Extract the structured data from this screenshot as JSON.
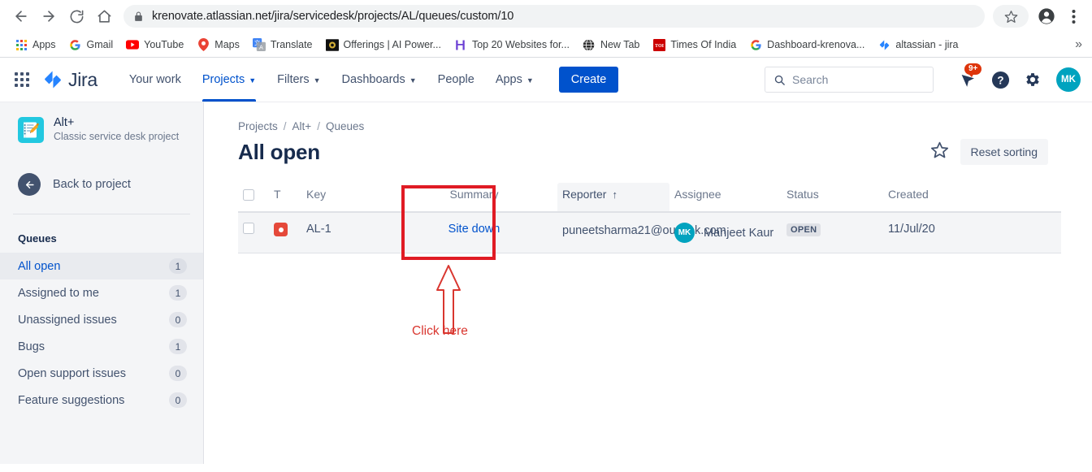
{
  "browser": {
    "url": "krenovate.atlassian.net/jira/servicedesk/projects/AL/queues/custom/10",
    "nav": {
      "back": "back-icon",
      "forward": "forward-icon",
      "reload": "reload-icon",
      "home": "home-icon"
    },
    "toolbar_right": {
      "bookmark_star": "star-icon",
      "profile": "profile-icon",
      "menu": "three-dot-menu-icon"
    },
    "bookmarks": [
      {
        "label": "Apps",
        "icon": "apps-grid-icon"
      },
      {
        "label": "Gmail",
        "icon": "gmail-icon"
      },
      {
        "label": "YouTube",
        "icon": "youtube-icon"
      },
      {
        "label": "Maps",
        "icon": "maps-pin-icon"
      },
      {
        "label": "Translate",
        "icon": "translate-icon"
      },
      {
        "label": "Offerings | AI Power...",
        "icon": "offerings-icon"
      },
      {
        "label": "Top 20 Websites for...",
        "icon": "top20-icon"
      },
      {
        "label": "New Tab",
        "icon": "globe-icon"
      },
      {
        "label": "Times Of India",
        "icon": "times-of-india-icon"
      },
      {
        "label": "Dashboard-krenova...",
        "icon": "google-icon"
      },
      {
        "label": "altassian - jira",
        "icon": "jira-icon"
      }
    ],
    "bookmarks_overflow": "»"
  },
  "jira_nav": {
    "app_switcher": "app-switcher-icon",
    "logo_text": "Jira",
    "items": [
      {
        "label": "Your work",
        "has_caret": false,
        "active": false
      },
      {
        "label": "Projects",
        "has_caret": true,
        "active": true
      },
      {
        "label": "Filters",
        "has_caret": true,
        "active": false
      },
      {
        "label": "Dashboards",
        "has_caret": true,
        "active": false
      },
      {
        "label": "People",
        "has_caret": false,
        "active": false
      },
      {
        "label": "Apps",
        "has_caret": true,
        "active": false
      }
    ],
    "create_label": "Create",
    "search_placeholder": "Search",
    "notification_count": "9+",
    "help_icon": "help-question-icon",
    "settings_icon": "gear-icon",
    "profile_initials": "MK",
    "profile_color": "#00a3bf"
  },
  "sidebar": {
    "project_name": "Alt+",
    "project_type": "Classic service desk project",
    "project_icon": "notepad-pencil-icon",
    "back_label": "Back to project",
    "back_icon": "arrow-left-circle-icon",
    "section_title": "Queues",
    "queues": [
      {
        "label": "All open",
        "count": "1",
        "active": true
      },
      {
        "label": "Assigned to me",
        "count": "1",
        "active": false
      },
      {
        "label": "Unassigned issues",
        "count": "0",
        "active": false
      },
      {
        "label": "Bugs",
        "count": "1",
        "active": false
      },
      {
        "label": "Open support issues",
        "count": "0",
        "active": false
      },
      {
        "label": "Feature suggestions",
        "count": "0",
        "active": false
      }
    ]
  },
  "main": {
    "breadcrumb": [
      "Projects",
      "Alt+",
      "Queues"
    ],
    "breadcrumb_sep": "/",
    "page_title": "All open",
    "star_icon": "star-outline-icon",
    "reset_sorting_label": "Reset sorting",
    "table": {
      "columns": [
        {
          "key": "checkbox",
          "label": "",
          "sorted": false
        },
        {
          "key": "type",
          "label": "T",
          "sorted": false
        },
        {
          "key": "issue_key",
          "label": "Key",
          "sorted": false
        },
        {
          "key": "summary",
          "label": "Summary",
          "sorted": false
        },
        {
          "key": "reporter",
          "label": "Reporter",
          "sorted": true,
          "sort_dir": "↑"
        },
        {
          "key": "assignee",
          "label": "Assignee",
          "sorted": false
        },
        {
          "key": "status",
          "label": "Status",
          "sorted": false
        },
        {
          "key": "created",
          "label": "Created",
          "sorted": false
        }
      ],
      "rows": [
        {
          "type_icon": "incident-red-icon",
          "issue_key": "AL-1",
          "summary": "Site down",
          "reporter": "puneetsharma21@outlook.com",
          "assignee_initials": "MK",
          "assignee_color": "#00a3bf",
          "assignee": "Manjeet Kaur",
          "status": "OPEN",
          "created": "11/Jul/20"
        }
      ]
    }
  },
  "annotations": {
    "highlight_color": "#e01b24",
    "arrow_color": "#d9362f",
    "callout_text": "Click here",
    "callout_color": "#d9362f"
  }
}
